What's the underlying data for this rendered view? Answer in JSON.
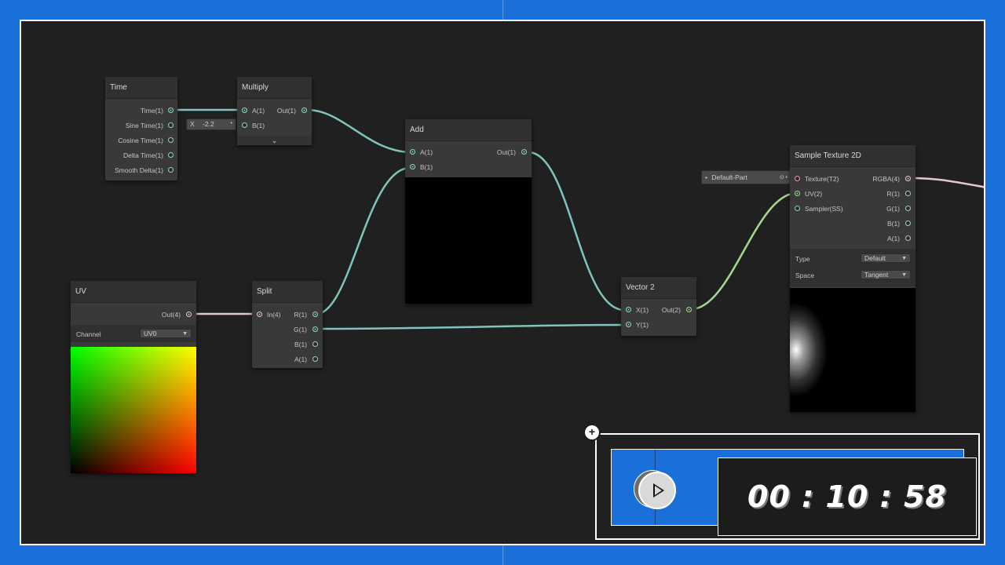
{
  "nodes": {
    "time": {
      "title": "Time",
      "outputs": [
        "Time(1)",
        "Sine Time(1)",
        "Cosine Time(1)",
        "Delta Time(1)",
        "Smooth Delta(1)"
      ]
    },
    "multiply": {
      "title": "Multiply",
      "inputs": [
        "A(1)",
        "B(1)"
      ],
      "outputs": [
        "Out(1)"
      ],
      "b_field": {
        "axis": "X",
        "value": "-2.2"
      }
    },
    "add": {
      "title": "Add",
      "inputs": [
        "A(1)",
        "B(1)"
      ],
      "outputs": [
        "Out(1)"
      ]
    },
    "uv": {
      "title": "UV",
      "outputs": [
        "Out(4)"
      ],
      "channel_label": "Channel",
      "channel_value": "UV0"
    },
    "split": {
      "title": "Split",
      "inputs": [
        "In(4)"
      ],
      "outputs": [
        "R(1)",
        "G(1)",
        "B(1)",
        "A(1)"
      ]
    },
    "vector2": {
      "title": "Vector 2",
      "inputs": [
        "X(1)",
        "Y(1)"
      ],
      "outputs": [
        "Out(2)"
      ]
    },
    "sample_texture": {
      "title": "Sample Texture 2D",
      "inputs": [
        "Texture(T2)",
        "UV(2)",
        "Sampler(SS)"
      ],
      "outputs": [
        "RGBA(4)",
        "R(1)",
        "G(1)",
        "B(1)",
        "A(1)"
      ],
      "type_label": "Type",
      "type_value": "Default",
      "space_label": "Space",
      "space_value": "Tangent",
      "texture_field": "Default-Part"
    }
  },
  "timer": {
    "text": "00 : 10 : 58",
    "add_symbol": "+"
  },
  "colors": {
    "frame": "#1a6fd9",
    "canvas": "#202020",
    "wire_float": "#7fc4bd",
    "wire_vec2": "#a3d98c",
    "wire_vec4": "#e5c4d6"
  },
  "icons": [
    "play-icon",
    "caret-down-icon",
    "chevron-down-icon",
    "gear-icon"
  ]
}
